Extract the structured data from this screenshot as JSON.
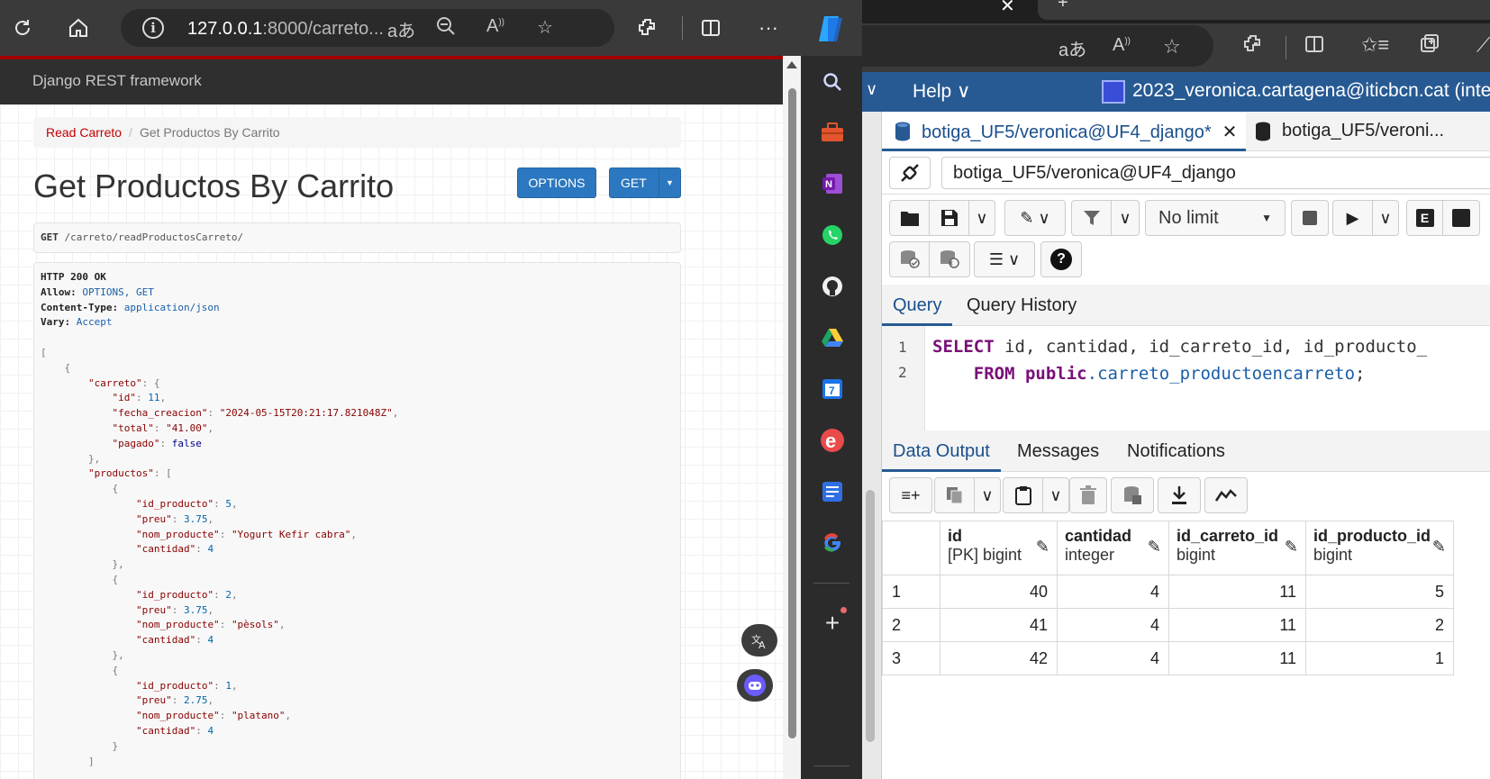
{
  "left_browser": {
    "address": {
      "host": "127.0.0.1",
      "rest": ":8000/carreto..."
    },
    "drf": {
      "brand": "Django REST framework",
      "breadcrumb": {
        "parent": "Read Carreto",
        "separator": "/",
        "current": "Get Productos By Carrito"
      },
      "title": "Get Productos By Carrito",
      "options_label": "OPTIONS",
      "get_label": "GET",
      "request": {
        "method": "GET",
        "path": "/carreto/readProductosCarreto/"
      },
      "response": {
        "status": "HTTP 200 OK",
        "allow_key": "Allow:",
        "allow_val": "OPTIONS, GET",
        "ctype_key": "Content-Type:",
        "ctype_val": "application/json",
        "vary_key": "Vary:",
        "vary_val": "Accept",
        "carreto": {
          "id": "11",
          "fecha_creacion": "\"2024-05-15T20:21:17.821048Z\"",
          "total": "\"41.00\"",
          "pagado": "false"
        },
        "productos": [
          {
            "id_producto": "5",
            "preu": "3.75",
            "nom_producte": "\"Yogurt Kefir cabra\"",
            "cantidad": "4"
          },
          {
            "id_producto": "2",
            "preu": "3.75",
            "nom_producte": "\"pèsols\"",
            "cantidad": "4"
          },
          {
            "id_producto": "1",
            "preu": "2.75",
            "nom_producte": "\"platano\"",
            "cantidad": "4"
          }
        ]
      }
    },
    "sidebar_icons": [
      "search-icon",
      "toolbox-icon",
      "onenote-icon",
      "whatsapp-icon",
      "github-icon",
      "drive-icon",
      "calendar-icon",
      "e-icon",
      "docs-icon",
      "google-icon",
      "add-icon"
    ]
  },
  "pgadmin": {
    "menu": {
      "help": "Help",
      "user": "2023_veronica.cartagena@iticbcn.cat (inte"
    },
    "tabs": [
      {
        "label": "botiga_UF5/veronica@UF4_django*",
        "close": "✕"
      },
      {
        "label": "botiga_UF5/veroni..."
      }
    ],
    "connection": "botiga_UF5/veronica@UF4_django",
    "limit": "No limit",
    "query_tabs": [
      "Query",
      "Query History"
    ],
    "sql": {
      "line1_num": "1",
      "line2_num": "2",
      "l1_kw": "SELECT",
      "l1_rest": " id, cantidad, id_carreto_id, id_producto_",
      "l1_id": "id",
      "l2_kw": "FROM",
      "l2_schema": "public",
      "l2_table": ".carreto_productoencarreto",
      "l2_end": ";"
    },
    "output_tabs": [
      "Data Output",
      "Messages",
      "Notifications"
    ],
    "columns": [
      {
        "name": "id",
        "type": "[PK] bigint"
      },
      {
        "name": "cantidad",
        "type": "integer"
      },
      {
        "name": "id_carreto_id",
        "type": "bigint"
      },
      {
        "name": "id_producto_id",
        "type": "bigint"
      }
    ],
    "rows": [
      {
        "n": "1",
        "id": "40",
        "cantidad": "4",
        "id_carreto_id": "11",
        "id_producto_id": "5"
      },
      {
        "n": "2",
        "id": "41",
        "cantidad": "4",
        "id_carreto_id": "11",
        "id_producto_id": "2"
      },
      {
        "n": "3",
        "id": "42",
        "cantidad": "4",
        "id_carreto_id": "11",
        "id_producto_id": "1"
      }
    ]
  }
}
